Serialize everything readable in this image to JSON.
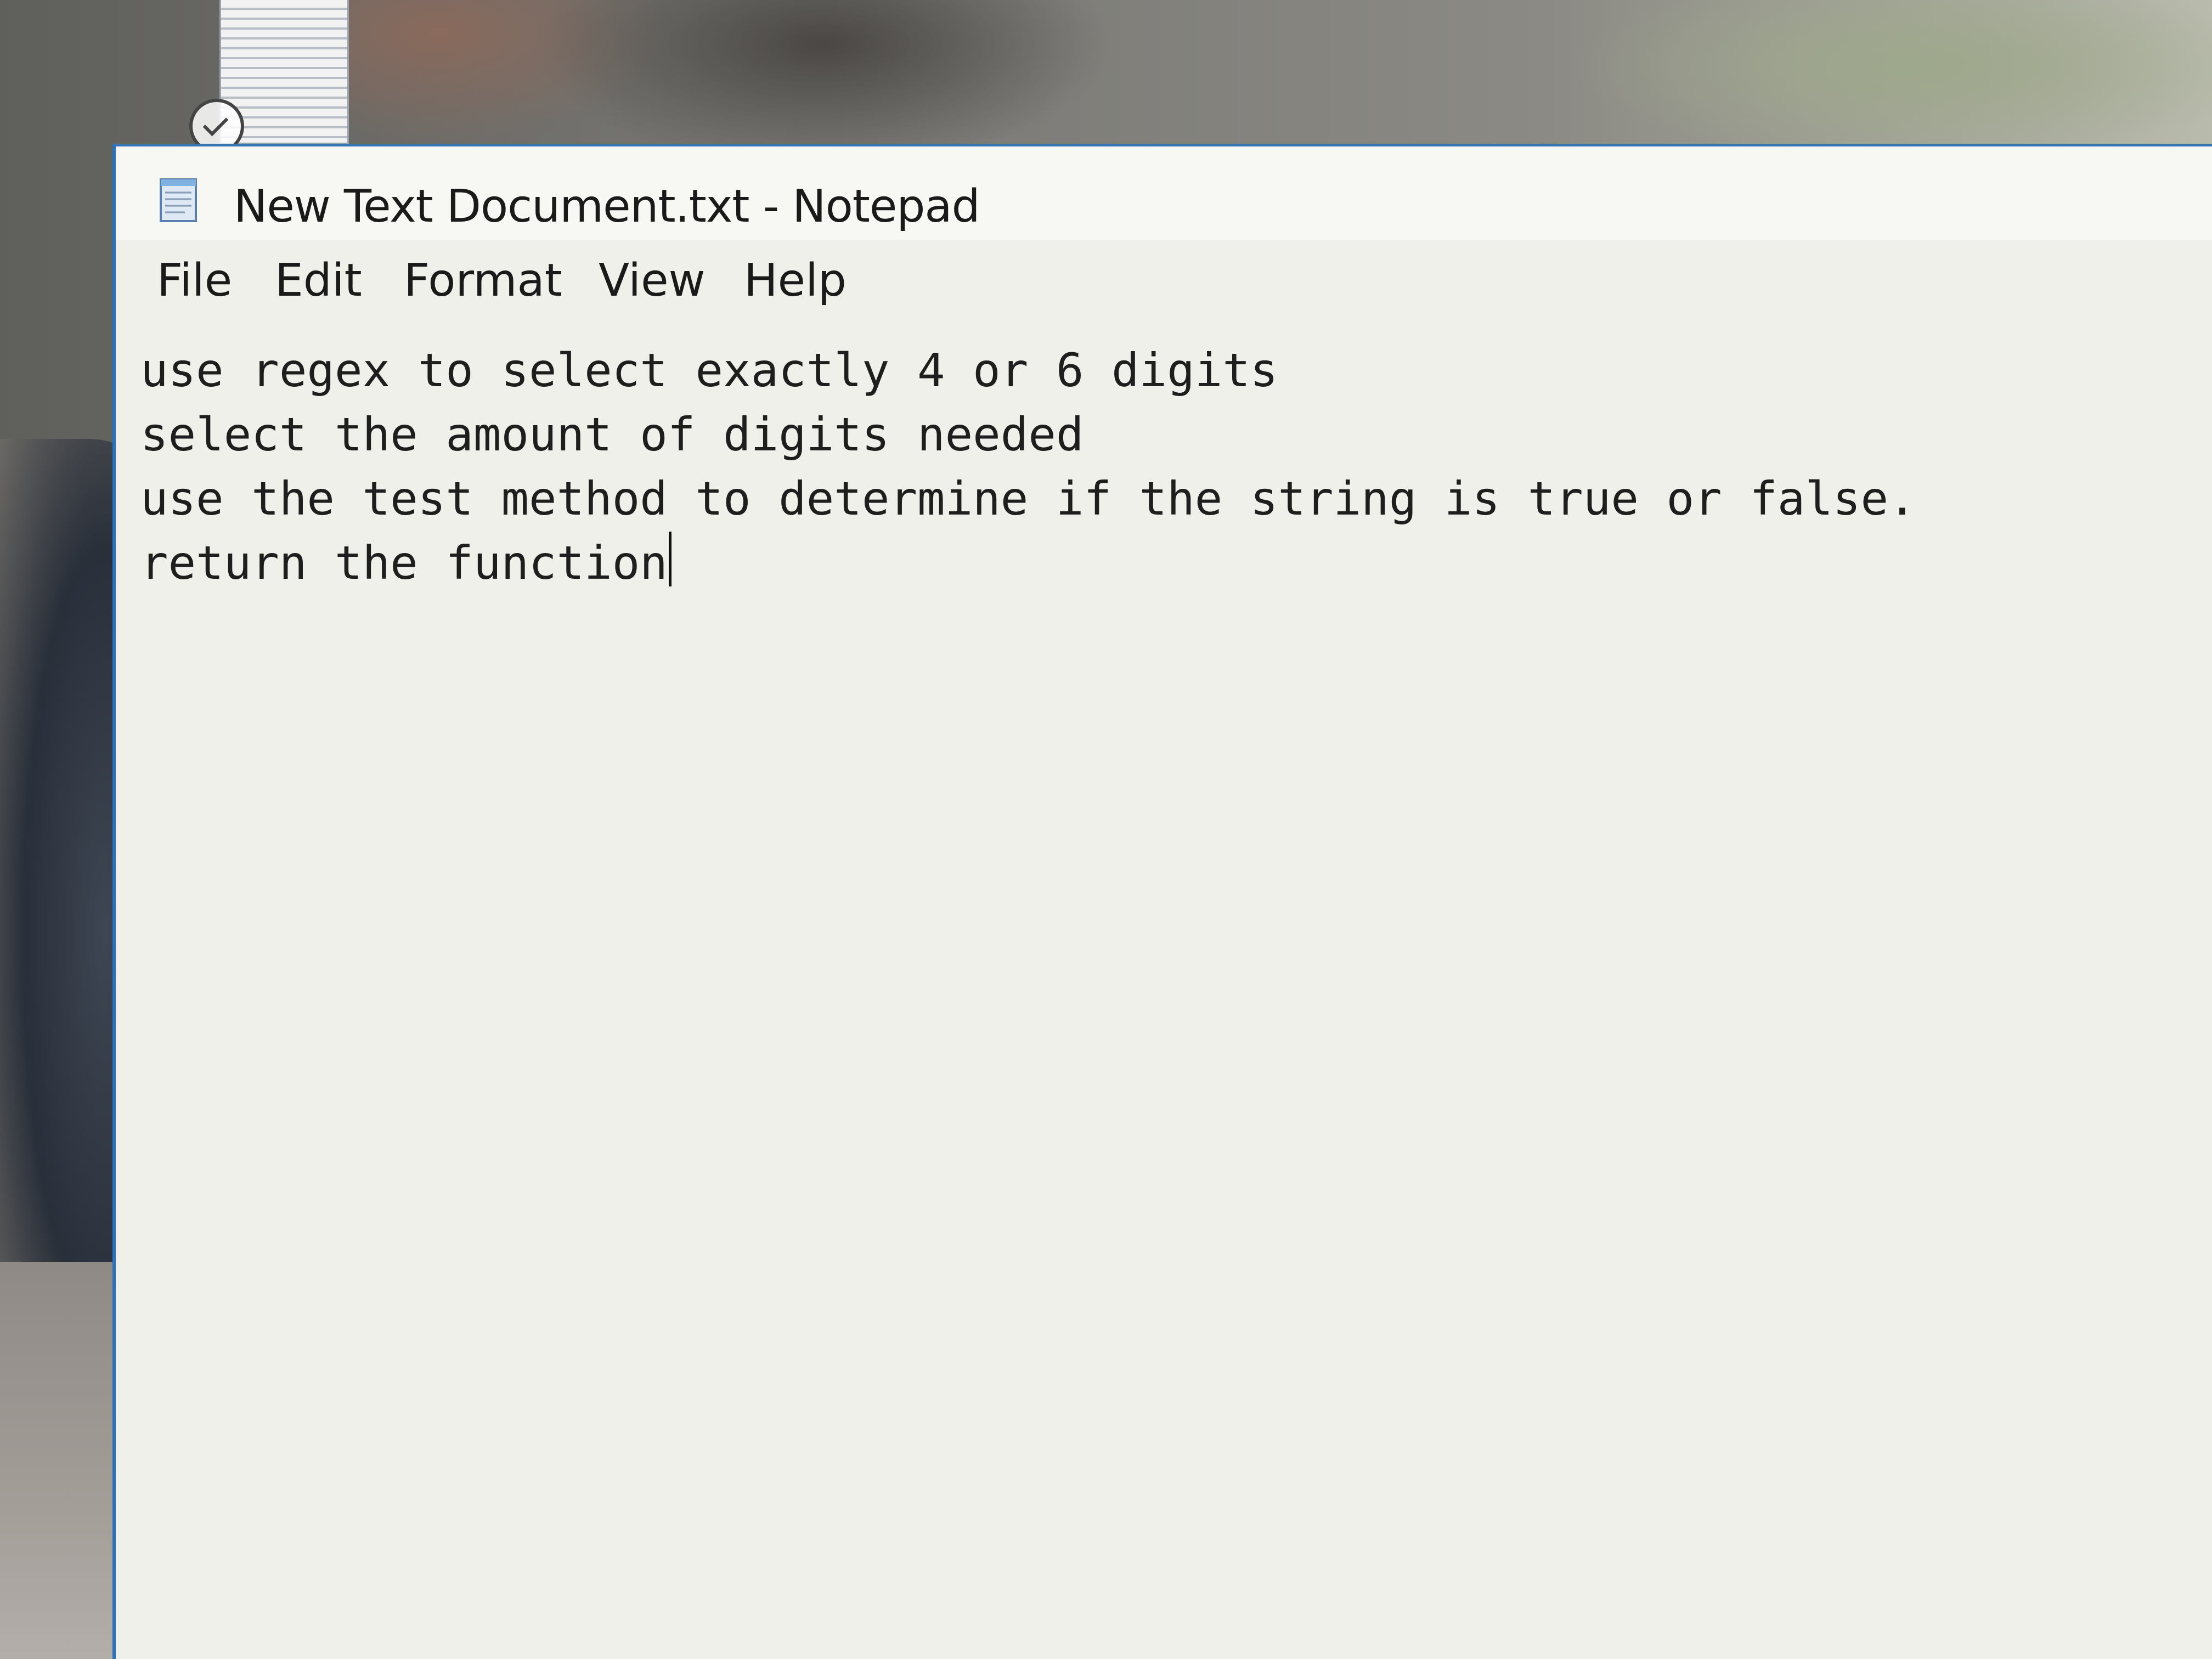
{
  "window": {
    "title": "New Text Document.txt - Notepad",
    "app_icon": "notepad-icon"
  },
  "menu": {
    "file": "File",
    "edit": "Edit",
    "format": "Format",
    "view": "View",
    "help": "Help"
  },
  "document": {
    "lines": [
      "use regex to select exactly 4 or 6 digits",
      "select the amount of digits needed",
      "use the test method to determine if the string is true or false.",
      "return the function"
    ]
  },
  "colors": {
    "window_border": "#2f6fb3",
    "editor_background": "#eef0e9"
  }
}
